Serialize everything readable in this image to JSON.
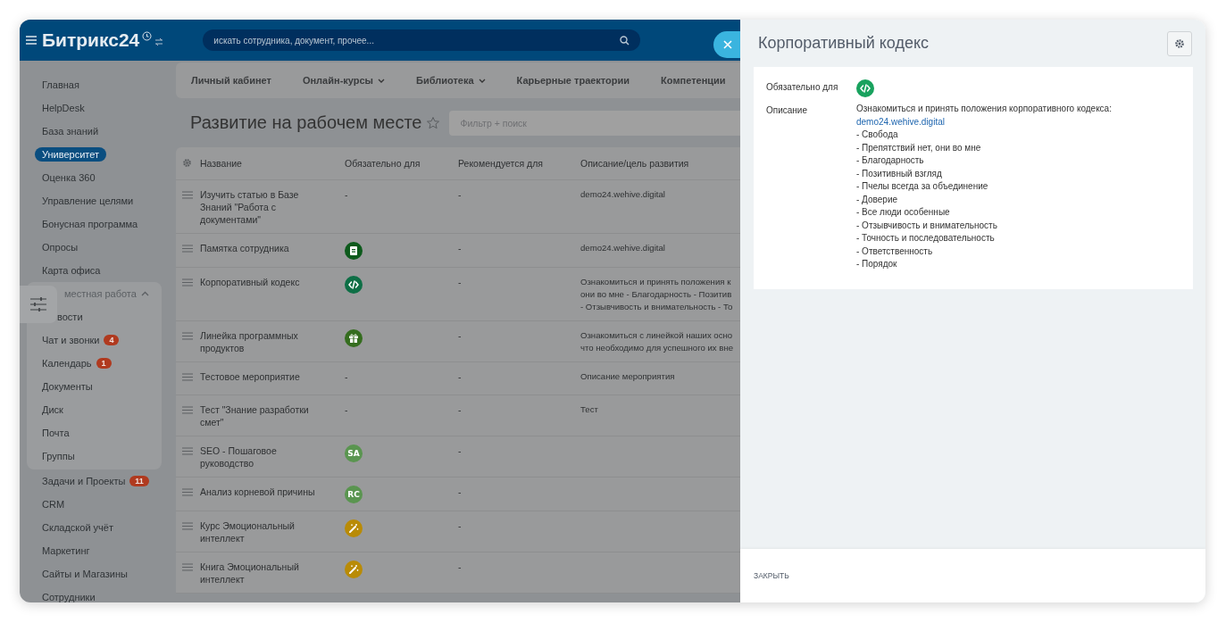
{
  "header": {
    "logo": "Битрикс24",
    "search_placeholder": "искать сотрудника, документ, прочее..."
  },
  "sidebar": {
    "items": [
      {
        "label": "Главная",
        "selected": false
      },
      {
        "label": "HelpDesk",
        "selected": false
      },
      {
        "label": "База знаний",
        "selected": false
      },
      {
        "label": "Университет",
        "selected": true
      },
      {
        "label": "Оценка 360",
        "selected": false
      },
      {
        "label": "Управление целями",
        "selected": false
      },
      {
        "label": "Бонусная программа",
        "selected": false
      },
      {
        "label": "Опросы",
        "selected": false
      },
      {
        "label": "Карта офиса",
        "selected": false
      },
      {
        "kind": "group",
        "label": "местная работа",
        "expanded": true,
        "children": [
          {
            "label": "вости",
            "selected": false
          },
          {
            "label": "Чат и звонки",
            "selected": false,
            "counter": "4"
          },
          {
            "label": "Календарь",
            "selected": false,
            "counter": "1"
          },
          {
            "label": "Документы",
            "selected": false
          },
          {
            "label": "Диск",
            "selected": false
          },
          {
            "label": "Почта",
            "selected": false
          },
          {
            "label": "Группы",
            "selected": false
          }
        ]
      },
      {
        "label": "Задачи и Проекты",
        "selected": false,
        "counter": "11"
      },
      {
        "label": "CRM",
        "selected": false
      },
      {
        "label": "Складской учёт",
        "selected": false
      },
      {
        "label": "Маркетинг",
        "selected": false
      },
      {
        "label": "Сайты и Магазины",
        "selected": false
      },
      {
        "label": "Сотрудники",
        "selected": false
      }
    ]
  },
  "nav": {
    "items": [
      {
        "label": "Личный кабинет",
        "has_menu": false
      },
      {
        "label": "Онлайн-курсы",
        "has_menu": true
      },
      {
        "label": "Библиотека",
        "has_menu": true
      },
      {
        "label": "Карьерные траектории",
        "has_menu": false
      },
      {
        "label": "Компетенции",
        "has_menu": false
      }
    ]
  },
  "page": {
    "title": "Развитие на рабочем месте",
    "favorite": false,
    "filter_placeholder": "Фильтр + поиск"
  },
  "table": {
    "columns": [
      "Название",
      "Обязательно для",
      "Рекомендуется для",
      "Описание/цель развития"
    ],
    "rows": [
      {
        "name": "Изучить статью в Базе Знаний \"Работа с документами\"",
        "required": {
          "kind": "text",
          "text": "-"
        },
        "recommended": "-",
        "description": [
          "demo24.wehive.digital"
        ]
      },
      {
        "name": "Памятка сотрудника",
        "required": {
          "kind": "book",
          "color": "#0d5a1c"
        },
        "recommended": "-",
        "description": [
          "demo24.wehive.digital"
        ]
      },
      {
        "name": "Корпоративный кодекс",
        "required": {
          "kind": "code",
          "color": "#0e6f46"
        },
        "recommended": "-",
        "description": [
          "Ознакомиться и принять положения к",
          "они во мне - Благодарность - Позитив",
          "- Отзывчивость и внимательность - То"
        ]
      },
      {
        "name": "Линейка программных продуктов",
        "required": {
          "kind": "gift",
          "color": "#356d1f"
        },
        "recommended": "-",
        "description": [
          "Ознакомиться с линейкой наших осно",
          "что необходимо для успешного их вне"
        ]
      },
      {
        "name": "Тестовое мероприятие",
        "required": {
          "kind": "text",
          "text": "-"
        },
        "recommended": "-",
        "description": [
          "Описание мероприятия"
        ]
      },
      {
        "name": "Тест \"Знание разработки смет\"",
        "required": {
          "kind": "text",
          "text": "-"
        },
        "recommended": "-",
        "description": [
          "Тест"
        ]
      },
      {
        "name": "SEO - Пошаговое руководство",
        "required": {
          "kind": "initials",
          "text": "SA",
          "color": "#5a9550"
        },
        "recommended": "-"
      },
      {
        "name": "Анализ корневой причины",
        "required": {
          "kind": "initials",
          "text": "RC",
          "color": "#5a9550"
        },
        "recommended": "-"
      },
      {
        "name": "Курс Эмоциональный интеллект",
        "required": {
          "kind": "wand",
          "color": "#b98b06"
        },
        "recommended": "-"
      },
      {
        "name": "Книга Эмоциональный интеллект",
        "required": {
          "kind": "wand",
          "color": "#b98b06"
        },
        "recommended": "-"
      }
    ]
  },
  "panel": {
    "title": "Корпоративный кодекс",
    "fields": [
      {
        "kind": "badges",
        "label": "Обязательно для",
        "badge": {
          "kind": "code",
          "color": "#19a25e"
        }
      },
      {
        "kind": "text",
        "label": "Описание",
        "intro": "Ознакомиться и принять положения корпоративного кодекса:",
        "link": "demo24.wehive.digital",
        "lines": [
          "- Свобода",
          "- Препятствий нет, они во мне",
          "- Благодарность",
          "- Позитивный взгляд",
          "- Пчелы всегда за объединение",
          "- Доверие",
          "- Все люди особенные",
          "- Отзывчивость и внимательность",
          "- Точность и последовательность",
          "- Ответственность",
          "- Порядок"
        ]
      }
    ],
    "close_label": "ЗАКРЫТЬ"
  }
}
